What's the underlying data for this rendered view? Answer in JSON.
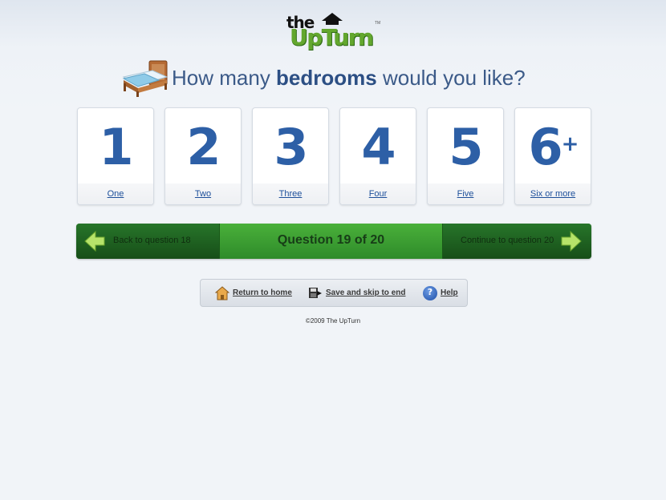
{
  "logo": {
    "the": "the",
    "upturn": "UpTurn",
    "tm": "TM"
  },
  "question": {
    "prefix": "How many ",
    "emphasis": "bedrooms",
    "suffix": " would you like?"
  },
  "options": [
    {
      "number": "1",
      "label": "One"
    },
    {
      "number": "2",
      "label": "Two"
    },
    {
      "number": "3",
      "label": "Three"
    },
    {
      "number": "4",
      "label": "Four"
    },
    {
      "number": "5",
      "label": "Five"
    },
    {
      "number": "6",
      "plus": "+",
      "label": "Six or more"
    }
  ],
  "nav": {
    "back_label": "Back to question 18",
    "progress_label": "Question 19 of 20",
    "next_label": "Continue to question 20"
  },
  "toolbar": {
    "home_label": "Return to home",
    "save_label": "Save and skip to end",
    "help_label": "Help",
    "help_glyph": "?"
  },
  "footer": {
    "copyright": "©2009 The UpTurn"
  },
  "colors": {
    "accent": "#2d5fa6",
    "nav_green": "#2e8b2a",
    "logo_green": "#63a72e"
  },
  "icons": [
    "bed-icon",
    "arrow-left-icon",
    "arrow-right-icon",
    "home-icon",
    "save-skip-icon",
    "help-icon"
  ]
}
